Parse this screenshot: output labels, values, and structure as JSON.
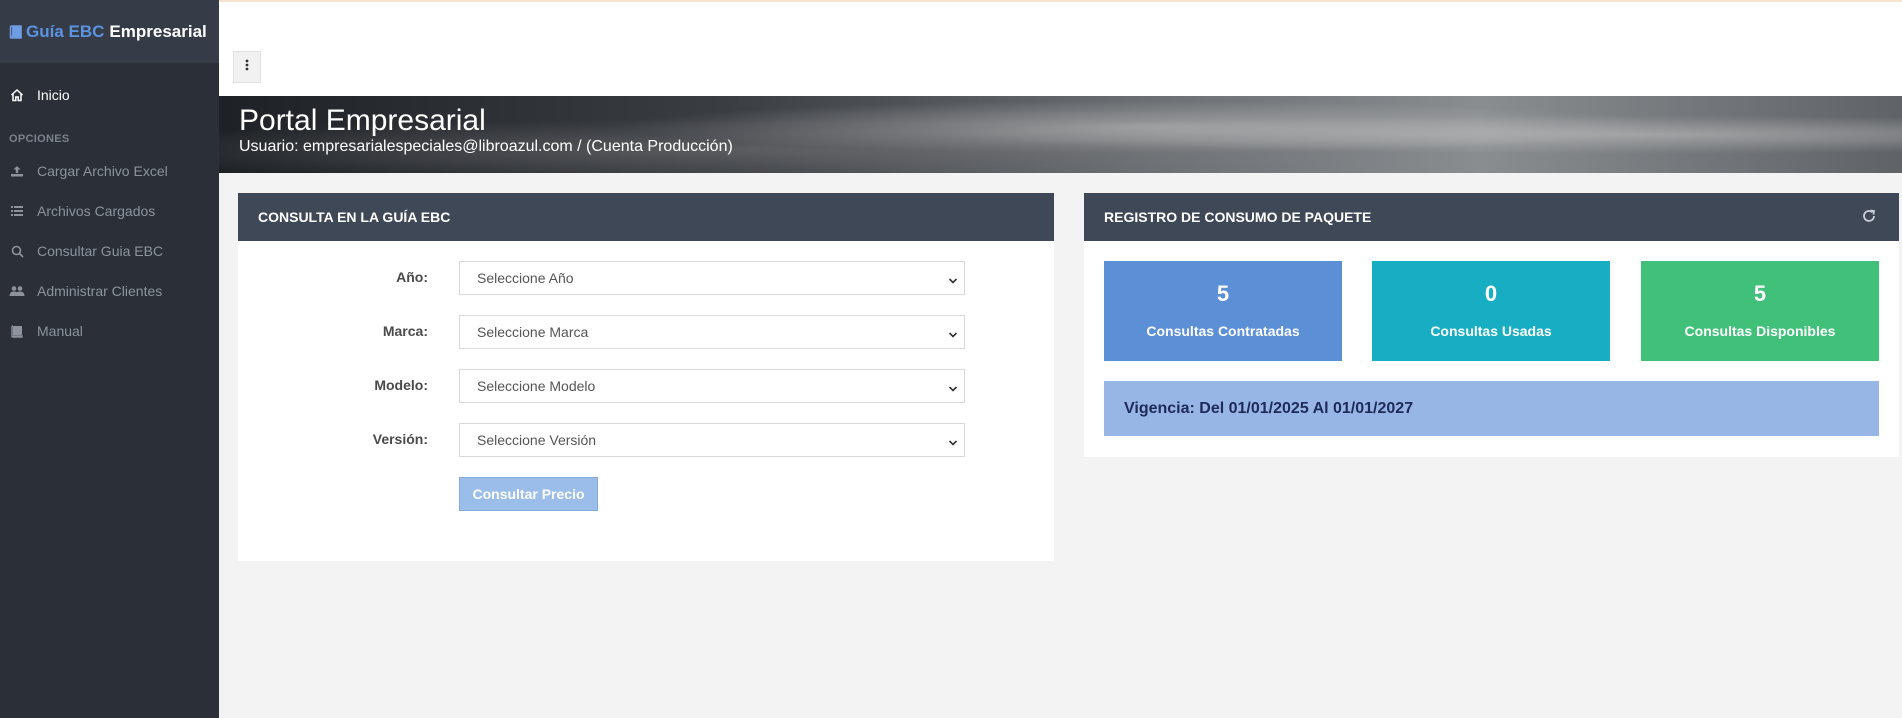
{
  "brand": {
    "part1": "Guía EBC",
    "part2": "Empresarial"
  },
  "sidebar": {
    "home_label": "Inicio",
    "section_label": "OPCIONES",
    "items": [
      {
        "label": "Cargar Archivo Excel",
        "icon": "upload-icon"
      },
      {
        "label": "Archivos Cargados",
        "icon": "list-icon"
      },
      {
        "label": "Consultar Guia EBC",
        "icon": "search-icon"
      },
      {
        "label": "Administrar Clientes",
        "icon": "users-icon"
      },
      {
        "label": "Manual",
        "icon": "book-icon"
      }
    ]
  },
  "banner": {
    "title": "Portal Empresarial",
    "subtitle": "Usuario: empresarialespeciales@libroazul.com / (Cuenta Producción)"
  },
  "consulta": {
    "title": "CONSULTA EN LA GUÍA EBC",
    "fields": [
      {
        "label": "Año:",
        "value": "Seleccione Año"
      },
      {
        "label": "Marca:",
        "value": "Seleccione Marca"
      },
      {
        "label": "Modelo:",
        "value": "Seleccione Modelo"
      },
      {
        "label": "Versión:",
        "value": "Seleccione Versión"
      }
    ],
    "button": "Consultar Precio"
  },
  "registro": {
    "title": "REGISTRO DE CONSUMO DE PAQUETE",
    "stats": [
      {
        "value": "5",
        "label": "Consultas Contratadas",
        "color": "#5b8fd6"
      },
      {
        "value": "0",
        "label": "Consultas Usadas",
        "color": "#17aec4"
      },
      {
        "value": "5",
        "label": "Consultas Disponibles",
        "color": "#41c07a"
      }
    ],
    "vigencia": "Vigencia: Del 01/01/2025 Al 01/01/2027"
  },
  "colors": {
    "sidebar_bg": "#2b3038",
    "panel_header": "#3e4857",
    "accent": "#5b93e0"
  }
}
